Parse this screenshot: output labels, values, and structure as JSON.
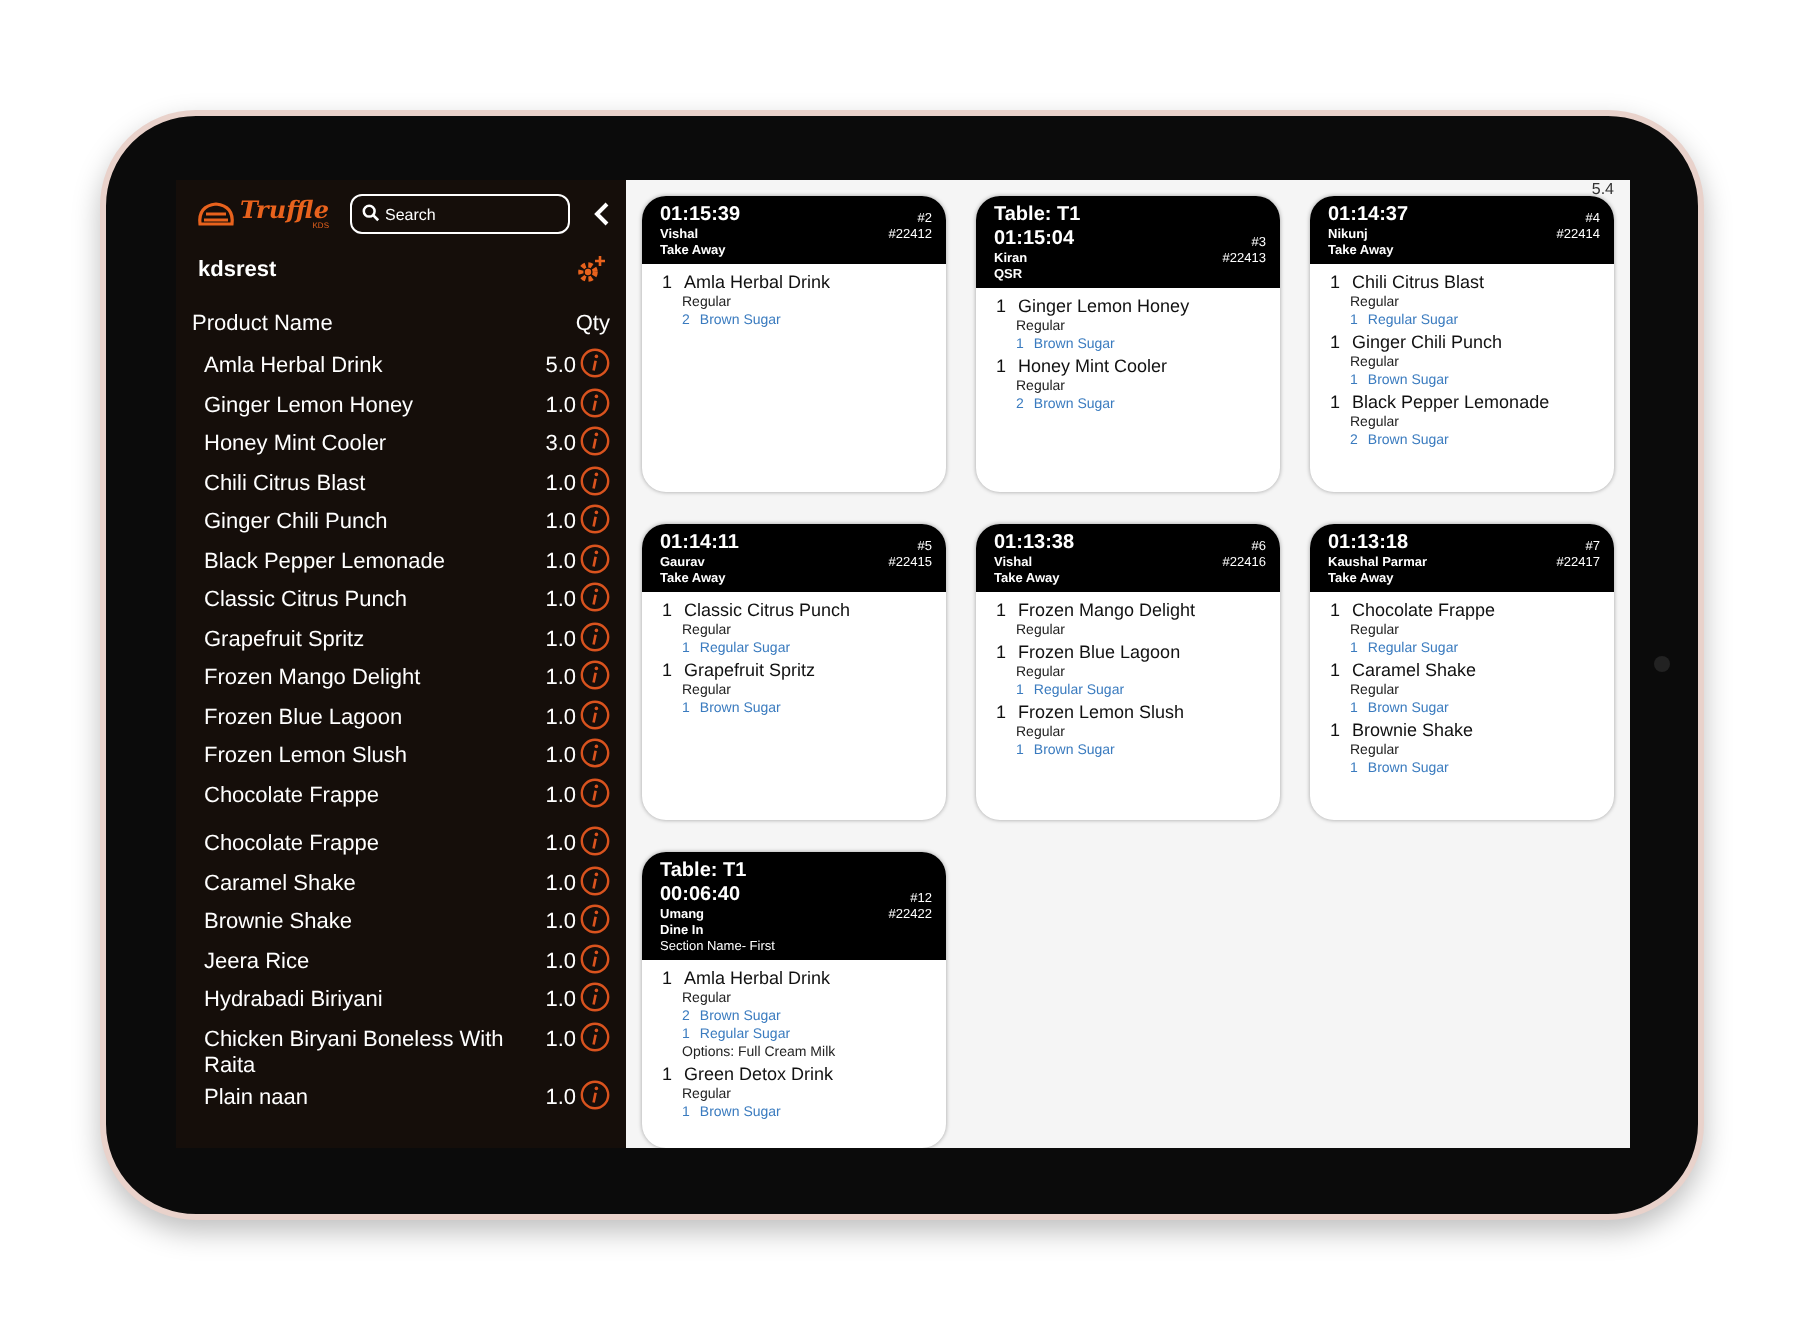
{
  "sidebar": {
    "logo": {
      "name": "Truffle",
      "sub": "KDS"
    },
    "search": {
      "placeholder": "Search"
    },
    "store": "kdsrest",
    "columns": [
      "Product Name",
      "Qty"
    ],
    "product_groups": [
      {
        "items": [
          {
            "name": "Amla Herbal Drink",
            "qty": "5.0"
          },
          {
            "name": "Ginger Lemon Honey",
            "qty": "1.0"
          },
          {
            "name": "Honey Mint Cooler",
            "qty": "3.0"
          },
          {
            "name": "Chili Citrus Blast",
            "qty": "1.0"
          },
          {
            "name": "Ginger Chili Punch",
            "qty": "1.0"
          },
          {
            "name": "Black Pepper Lemonade",
            "qty": "1.0"
          },
          {
            "name": "Classic Citrus Punch",
            "qty": "1.0"
          },
          {
            "name": "Grapefruit Spritz",
            "qty": "1.0"
          },
          {
            "name": "Frozen Mango Delight",
            "qty": "1.0"
          },
          {
            "name": "Frozen Blue Lagoon",
            "qty": "1.0"
          },
          {
            "name": "Frozen Lemon Slush",
            "qty": "1.0"
          },
          {
            "name": "Chocolate Frappe",
            "qty": "1.0"
          }
        ]
      },
      {
        "items": [
          {
            "name": "Chocolate Frappe",
            "qty": "1.0"
          },
          {
            "name": "Caramel Shake",
            "qty": "1.0"
          },
          {
            "name": "Brownie Shake",
            "qty": "1.0"
          },
          {
            "name": "Jeera Rice",
            "qty": "1.0"
          },
          {
            "name": "Hydrabadi Biriyani",
            "qty": "1.0"
          },
          {
            "name": "Chicken Biryani Boneless With Raita",
            "qty": "1.0"
          },
          {
            "name": "Plain naan",
            "qty": "1.0"
          }
        ]
      }
    ]
  },
  "version": "5.4",
  "orders": [
    {
      "time": "01:15:39",
      "number": "#2",
      "customer": "Vishal",
      "order_id": "#22412",
      "type": "Take Away",
      "items": [
        {
          "qty": "1",
          "name": "Amla Herbal Drink",
          "variant": "Regular",
          "modifiers": [
            {
              "qty": "2",
              "name": "Brown Sugar"
            }
          ]
        }
      ]
    },
    {
      "table": "Table: T1",
      "time": "01:15:04",
      "number": "#3",
      "customer": "Kiran",
      "order_id": "#22413",
      "type": "QSR",
      "items": [
        {
          "qty": "1",
          "name": "Ginger Lemon Honey",
          "variant": "Regular",
          "modifiers": [
            {
              "qty": "1",
              "name": "Brown Sugar"
            }
          ]
        },
        {
          "qty": "1",
          "name": "Honey Mint Cooler",
          "variant": "Regular",
          "modifiers": [
            {
              "qty": "2",
              "name": "Brown Sugar"
            }
          ]
        }
      ]
    },
    {
      "time": "01:14:37",
      "number": "#4",
      "customer": "Nikunj",
      "order_id": "#22414",
      "type": "Take Away",
      "items": [
        {
          "qty": "1",
          "name": "Chili Citrus Blast",
          "variant": "Regular",
          "modifiers": [
            {
              "qty": "1",
              "name": "Regular Sugar"
            }
          ]
        },
        {
          "qty": "1",
          "name": "Ginger Chili Punch",
          "variant": "Regular",
          "modifiers": [
            {
              "qty": "1",
              "name": "Brown Sugar"
            }
          ]
        },
        {
          "qty": "1",
          "name": "Black Pepper Lemonade",
          "variant": "Regular",
          "modifiers": [
            {
              "qty": "2",
              "name": "Brown Sugar"
            }
          ]
        }
      ]
    },
    {
      "time": "01:14:11",
      "number": "#5",
      "customer": "Gaurav",
      "order_id": "#22415",
      "type": "Take Away",
      "items": [
        {
          "qty": "1",
          "name": "Classic Citrus Punch",
          "variant": "Regular",
          "modifiers": [
            {
              "qty": "1",
              "name": "Regular Sugar"
            }
          ]
        },
        {
          "qty": "1",
          "name": "Grapefruit Spritz",
          "variant": "Regular",
          "modifiers": [
            {
              "qty": "1",
              "name": "Brown Sugar"
            }
          ]
        }
      ]
    },
    {
      "time": "01:13:38",
      "number": "#6",
      "customer": "Vishal",
      "order_id": "#22416",
      "type": "Take Away",
      "items": [
        {
          "qty": "1",
          "name": "Frozen Mango Delight",
          "variant": "Regular"
        },
        {
          "qty": "1",
          "name": "Frozen Blue Lagoon",
          "variant": "Regular",
          "modifiers": [
            {
              "qty": "1",
              "name": "Regular Sugar"
            }
          ]
        },
        {
          "qty": "1",
          "name": "Frozen Lemon Slush",
          "variant": "Regular",
          "modifiers": [
            {
              "qty": "1",
              "name": "Brown Sugar"
            }
          ]
        }
      ]
    },
    {
      "time": "01:13:18",
      "number": "#7",
      "customer": "Kaushal Parmar",
      "order_id": "#22417",
      "type": "Take Away",
      "items": [
        {
          "qty": "1",
          "name": "Chocolate Frappe",
          "variant": "Regular",
          "modifiers": [
            {
              "qty": "1",
              "name": "Regular Sugar"
            }
          ]
        },
        {
          "qty": "1",
          "name": "Caramel Shake",
          "variant": "Regular",
          "modifiers": [
            {
              "qty": "1",
              "name": "Brown Sugar"
            }
          ]
        },
        {
          "qty": "1",
          "name": "Brownie Shake",
          "variant": "Regular",
          "modifiers": [
            {
              "qty": "1",
              "name": "Brown Sugar"
            }
          ]
        }
      ]
    },
    {
      "table": "Table: T1",
      "time": "00:06:40",
      "number": "#12",
      "customer": "Umang",
      "order_id": "#22422",
      "type": "Dine In",
      "section": "Section Name- First",
      "items": [
        {
          "qty": "1",
          "name": "Amla Herbal Drink",
          "variant": "Regular",
          "modifiers": [
            {
              "qty": "2",
              "name": "Brown Sugar"
            },
            {
              "qty": "1",
              "name": "Regular Sugar"
            }
          ],
          "options": "Options: Full Cream Milk"
        },
        {
          "qty": "1",
          "name": "Green Detox Drink",
          "variant": "Regular",
          "modifiers": [
            {
              "qty": "1",
              "name": "Brown Sugar"
            }
          ]
        }
      ]
    }
  ]
}
